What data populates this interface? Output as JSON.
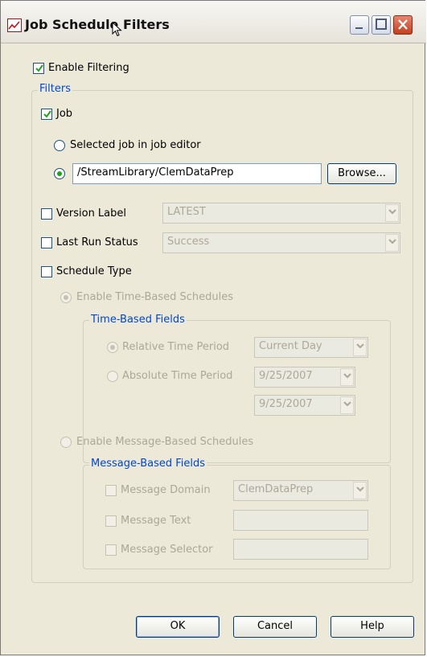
{
  "window": {
    "title": "Job Schedule Filters",
    "app_icon": "chart-icon",
    "controls": [
      "minimize-icon",
      "maximize-icon",
      "close-icon"
    ]
  },
  "enable_filtering": {
    "label": "Enable Filtering",
    "checked": true
  },
  "filters": {
    "title": "Filters",
    "job": {
      "label": "Job",
      "checked": true
    },
    "selected_job_option": {
      "label": "Selected job in job editor",
      "selected": false
    },
    "path_option": {
      "selected": true,
      "value": "/StreamLibrary/ClemDataPrep"
    },
    "browse_button": "Browse...",
    "version_label": {
      "label": "Version Label",
      "checked": false,
      "value": "LATEST"
    },
    "last_run_status": {
      "label": "Last Run Status",
      "checked": false,
      "value": "Success"
    },
    "schedule_type": {
      "label": "Schedule Type",
      "checked": false
    },
    "time_based": {
      "option_label": "Enable Time-Based Schedules",
      "group_title": "Time-Based Fields",
      "relative_label": "Relative Time Period",
      "relative_value": "Current Day",
      "absolute_label": "Absolute Time Period",
      "date_from": "9/25/2007",
      "date_to": "9/25/2007"
    },
    "message_based": {
      "option_label": "Enable Message-Based Schedules",
      "group_title": "Message-Based Fields",
      "domain_label": "Message Domain",
      "domain_value": "ClemDataPrep",
      "text_label": "Message Text",
      "text_value": "",
      "selector_label": "Message Selector",
      "selector_value": ""
    }
  },
  "buttons": {
    "ok": "OK",
    "cancel": "Cancel",
    "help": "Help"
  }
}
